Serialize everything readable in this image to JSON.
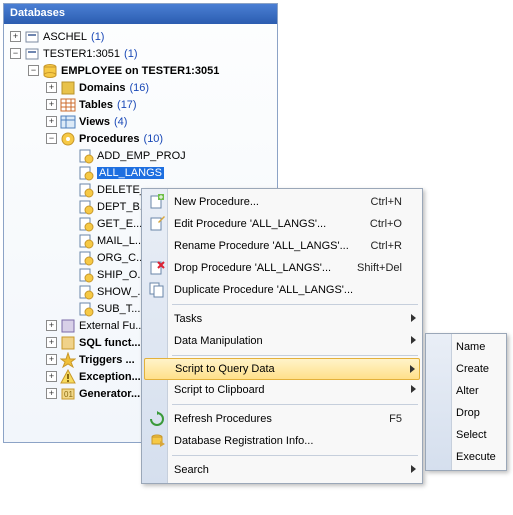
{
  "panel": {
    "title": "Databases"
  },
  "tree": {
    "aschel": {
      "label": "ASCHEL",
      "count": "(1)"
    },
    "tester": {
      "label": "TESTER1:3051",
      "count": "(1)"
    },
    "db": {
      "label": "EMPLOYEE on TESTER1:3051"
    },
    "domains": {
      "label": "Domains",
      "count": "(16)"
    },
    "tables": {
      "label": "Tables",
      "count": "(17)"
    },
    "views": {
      "label": "Views",
      "count": "(4)"
    },
    "procedures": {
      "label": "Procedures",
      "count": "(10)"
    },
    "procs": [
      "ADD_EMP_PROJ",
      "ALL_LANGS",
      "DELETE_...",
      "DEPT_B...",
      "GET_E...",
      "MAIL_L...",
      "ORG_C...",
      "SHIP_O...",
      "SHOW_...",
      "SUB_T..."
    ],
    "extfn": {
      "label": "External Fu..."
    },
    "sqlfn": {
      "label": "SQL funct..."
    },
    "triggers": {
      "label": "Triggers ..."
    },
    "exceptions": {
      "label": "Exception..."
    },
    "generators": {
      "label": "Generator..."
    }
  },
  "menu": {
    "new": "New Procedure...",
    "edit": "Edit Procedure 'ALL_LANGS'...",
    "rename": "Rename Procedure 'ALL_LANGS'...",
    "drop": "Drop Procedure 'ALL_LANGS'...",
    "dup": "Duplicate Procedure 'ALL_LANGS'...",
    "tasks": "Tasks",
    "datamanip": "Data Manipulation",
    "scriptquery": "Script to Query Data",
    "scriptclip": "Script to Clipboard",
    "refresh": "Refresh Procedures",
    "dbreg": "Database Registration Info...",
    "search": "Search",
    "sc_new": "Ctrl+N",
    "sc_edit": "Ctrl+O",
    "sc_rename": "Ctrl+R",
    "sc_drop": "Shift+Del",
    "sc_refresh": "F5"
  },
  "submenu": {
    "name": "Name",
    "create": "Create",
    "alter": "Alter",
    "drop": "Drop",
    "select": "Select",
    "execute": "Execute"
  }
}
